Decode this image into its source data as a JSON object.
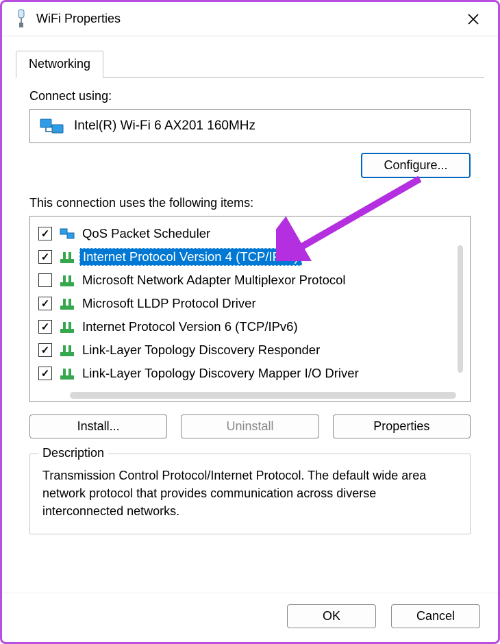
{
  "window": {
    "title": "WiFi Properties"
  },
  "tabs": {
    "networking": "Networking"
  },
  "connect": {
    "label": "Connect using:",
    "adapter": "Intel(R) Wi-Fi 6 AX201 160MHz"
  },
  "buttons": {
    "configure": "Configure...",
    "install": "Install...",
    "uninstall": "Uninstall",
    "properties": "Properties",
    "ok": "OK",
    "cancel": "Cancel"
  },
  "itemsLabel": "This connection uses the following items:",
  "items": [
    {
      "label": "QoS Packet Scheduler",
      "checked": true,
      "selected": false,
      "icon": "qos"
    },
    {
      "label": "Internet Protocol Version 4 (TCP/IPv4)",
      "checked": true,
      "selected": true,
      "icon": "net"
    },
    {
      "label": "Microsoft Network Adapter Multiplexor Protocol",
      "checked": false,
      "selected": false,
      "icon": "net"
    },
    {
      "label": "Microsoft LLDP Protocol Driver",
      "checked": true,
      "selected": false,
      "icon": "net"
    },
    {
      "label": "Internet Protocol Version 6 (TCP/IPv6)",
      "checked": true,
      "selected": false,
      "icon": "net"
    },
    {
      "label": "Link-Layer Topology Discovery Responder",
      "checked": true,
      "selected": false,
      "icon": "net"
    },
    {
      "label": "Link-Layer Topology Discovery Mapper I/O Driver",
      "checked": true,
      "selected": false,
      "icon": "net"
    }
  ],
  "description": {
    "legend": "Description",
    "text": "Transmission Control Protocol/Internet Protocol. The default wide area network protocol that provides communication across diverse interconnected networks."
  }
}
